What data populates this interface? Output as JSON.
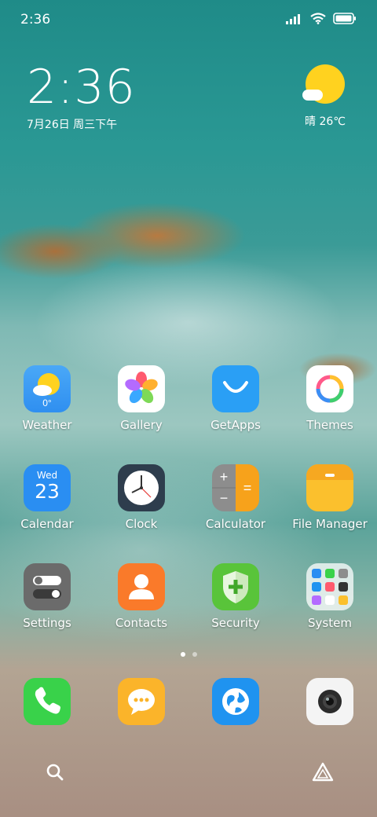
{
  "status_bar": {
    "time": "2:36"
  },
  "clock_widget": {
    "time": "2:36",
    "date": "7月26日 周三下午"
  },
  "weather_widget": {
    "text": "晴 26℃"
  },
  "apps": [
    {
      "label": "Weather",
      "icon": "weather-icon",
      "temp": "0°"
    },
    {
      "label": "Gallery",
      "icon": "gallery-icon"
    },
    {
      "label": "GetApps",
      "icon": "getapps-icon"
    },
    {
      "label": "Themes",
      "icon": "themes-icon"
    },
    {
      "label": "Calendar",
      "icon": "calendar-icon",
      "day": "Wed",
      "date": "23"
    },
    {
      "label": "Clock",
      "icon": "clock-icon"
    },
    {
      "label": "Calculator",
      "icon": "calculator-icon"
    },
    {
      "label": "File Manager",
      "icon": "file-manager-icon"
    },
    {
      "label": "Settings",
      "icon": "settings-icon"
    },
    {
      "label": "Contacts",
      "icon": "contacts-icon"
    },
    {
      "label": "Security",
      "icon": "security-icon"
    },
    {
      "label": "System",
      "icon": "folder-icon"
    }
  ],
  "dock": [
    {
      "icon": "phone-icon"
    },
    {
      "icon": "messages-icon"
    },
    {
      "icon": "browser-icon"
    },
    {
      "icon": "camera-icon"
    }
  ],
  "page_indicator": {
    "count": 2,
    "active": 1
  },
  "colors": {
    "weather_bg": "#2f8ff0",
    "getapps_bg": "#2a9ff5",
    "calendar_bg": "#2a8ef2",
    "clock_bg": "#2e3d4d",
    "calculator_orange": "#f7a21b",
    "file_manager_bg": "#fbc02d",
    "contacts_bg": "#fa7a2a",
    "security_bg": "#59c43a",
    "phone_bg": "#39d24a",
    "messages_bg": "#fbb42a",
    "browser_bg": "#1f93f0"
  }
}
